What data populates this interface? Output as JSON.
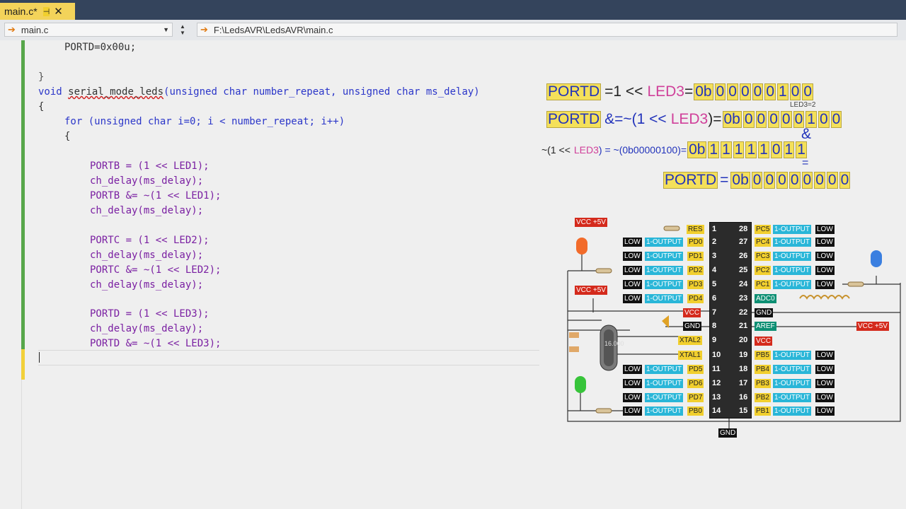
{
  "tab": {
    "title": "main.c*",
    "pin": "⊣",
    "close": "✕"
  },
  "nav": {
    "left_file": "main.c",
    "path": "F:\\LedsAVR\\LedsAVR\\main.c"
  },
  "code": {
    "l1": "PORTD=0x00u;",
    "l2": "}",
    "l3_kw": "void",
    "l3_fn": "serial_mode_leds",
    "l3_rest": "(unsigned char number_repeat, unsigned char ms_delay)",
    "l4": "{",
    "l5": "for (unsigned char i=0; i < number_repeat; i++)",
    "l6": "{",
    "l7": "PORTB = (1 << LED1);",
    "l8": "ch_delay(ms_delay);",
    "l9": "PORTB &= ~(1 << LED1);",
    "l10": "ch_delay(ms_delay);",
    "l11": "PORTC = (1 << LED2);",
    "l12": "ch_delay(ms_delay);",
    "l13": "PORTC &= ~(1 << LED2);",
    "l14": "ch_delay(ms_delay);",
    "l15": "PORTD = (1 << LED3);",
    "l16": "ch_delay(ms_delay);",
    "l17": "PORTD &= ~(1 << LED3);"
  },
  "annotation": {
    "row1": {
      "portd": "PORTD",
      "op": "=1 <<",
      "led": "LED3",
      "eq": "=",
      "prefix": "0b",
      "bits": [
        "0",
        "0",
        "0",
        "0",
        "0",
        "1",
        "0",
        "0"
      ]
    },
    "bit_note": "LED3=2",
    "row2": {
      "portd": "PORTD",
      "op": "&=~(1 <<",
      "led": "LED3",
      "close": ")=",
      "prefix": "0b",
      "bits": [
        "0",
        "0",
        "0",
        "0",
        "0",
        "1",
        "0",
        "0"
      ]
    },
    "amp": "&",
    "row3": {
      "left": "~(1 <<",
      "led": "LED3",
      "mid": ") = ~(0b00000100)=",
      "prefix": "0b",
      "bits": [
        "1",
        "1",
        "1",
        "1",
        "1",
        "0",
        "1",
        "1"
      ]
    },
    "eqsign": "=",
    "row4": {
      "portd": "PORTD",
      "eq": "=",
      "prefix": "0b",
      "bits": [
        "0",
        "0",
        "0",
        "0",
        "0",
        "0",
        "0",
        "0"
      ]
    }
  },
  "circuit": {
    "vcc5v": "VCC +5V",
    "res": "RES",
    "low": "LOW",
    "output": "1-OUTPUT",
    "left_pins": [
      "PD0",
      "PD1",
      "PD2",
      "PD3",
      "PD4"
    ],
    "vcc": "VCC",
    "gnd": "GND",
    "xtal2": "XTAL2",
    "xtal1": "XTAL1",
    "left_pins2": [
      "PD5",
      "PD6",
      "PD7",
      "PB0"
    ],
    "right_pins": [
      "PC5",
      "PC4",
      "PC3",
      "PC2",
      "PC1"
    ],
    "adc0": "ADC0",
    "aref": "AREF",
    "right_pins2": [
      "PB5",
      "PB4",
      "PB3",
      "PB2",
      "PB1"
    ],
    "left_nums": [
      "1",
      "2",
      "3",
      "4",
      "5",
      "6",
      "7",
      "8",
      "9",
      "10",
      "11",
      "12",
      "13",
      "14"
    ],
    "right_nums": [
      "28",
      "27",
      "26",
      "25",
      "24",
      "23",
      "22",
      "21",
      "20",
      "19",
      "18",
      "17",
      "16",
      "15"
    ],
    "crystal": "16.000"
  }
}
